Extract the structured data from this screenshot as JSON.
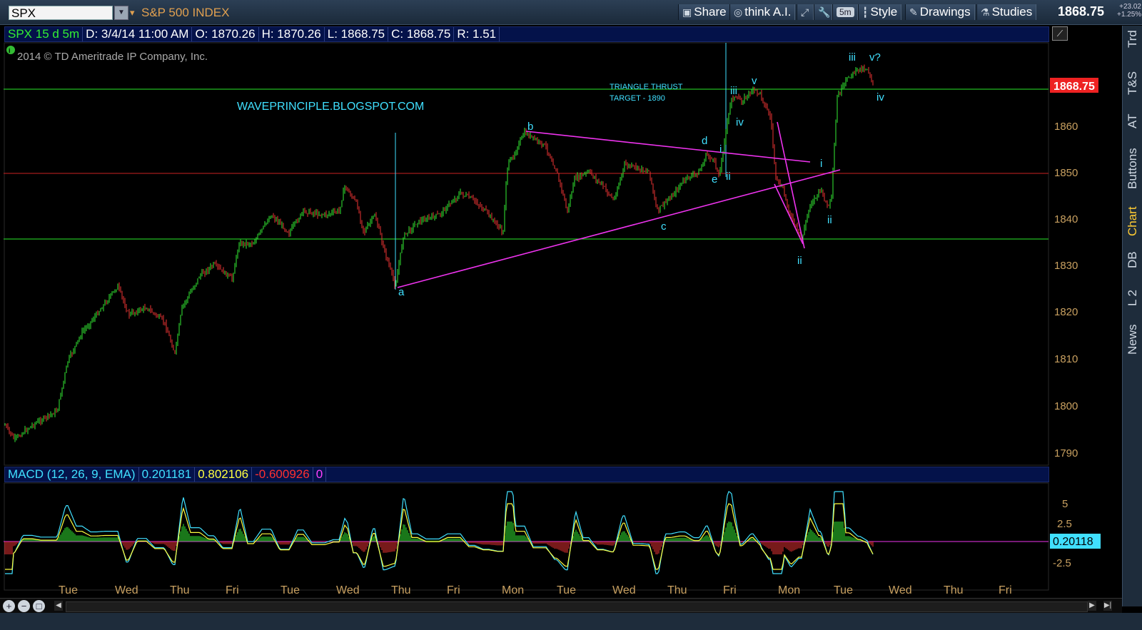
{
  "toolbar": {
    "symbol": "SPX",
    "index_title": "S&P 500 INDEX",
    "share_label": "Share",
    "thinkai_label": "think A.I.",
    "interval_label": "5m",
    "style_label": "Style",
    "drawings_label": "Drawings",
    "studies_label": "Studies",
    "last_price": "1868.75",
    "change_points": "+23.02",
    "change_pct": "+1.25%"
  },
  "right_tabs": [
    "Trd",
    "T&S",
    "AT",
    "Buttons",
    "Chart",
    "DB",
    "L 2",
    "News"
  ],
  "active_tab": "Chart",
  "info_bar": {
    "symbol_period": "SPX 15 d 5m",
    "date": "D: 3/4/14 11:00 AM",
    "open": "O: 1870.26",
    "high": "H: 1870.26",
    "low": "L: 1868.75",
    "close": "C: 1868.75",
    "range": "R: 1.51"
  },
  "copyright": "2014 © TD Ameritrade IP Company, Inc.",
  "annotations": {
    "blog": "WAVEPRINCIPLE.BLOGSPOT.COM",
    "thrust_line1": "TRIANGLE THRUST",
    "thrust_line2": "TARGET - 1890"
  },
  "wave_labels": [
    {
      "text": "a",
      "color": "#40e0ff"
    },
    {
      "text": "b",
      "color": "#40e0ff"
    },
    {
      "text": "c",
      "color": "#40e0ff"
    },
    {
      "text": "d",
      "color": "#40e0ff"
    },
    {
      "text": "e",
      "color": "#40e0ff"
    },
    {
      "text": "i",
      "color": "#40e0ff"
    },
    {
      "text": "ii",
      "color": "#40e0ff"
    },
    {
      "text": "iii",
      "color": "#40e0ff"
    },
    {
      "text": "iv",
      "color": "#40e0ff"
    },
    {
      "text": "v",
      "color": "#40e0ff"
    },
    {
      "text": "ii",
      "color": "#40e0ff"
    },
    {
      "text": "i",
      "color": "#40e0ff"
    },
    {
      "text": "ii",
      "color": "#40e0ff"
    },
    {
      "text": "iii",
      "color": "#40e0ff"
    },
    {
      "text": "v?",
      "color": "#40e0ff"
    },
    {
      "text": "iv",
      "color": "#40e0ff"
    }
  ],
  "price_axis": {
    "ticks": [
      "1790",
      "1800",
      "1810",
      "1820",
      "1830",
      "1840",
      "1850",
      "1860"
    ],
    "current_price_label": "1868.75"
  },
  "macd": {
    "label": "MACD (12, 26, 9, EMA)",
    "value": "0.201181",
    "avg": "0.802106",
    "diff": "-0.600926",
    "zero": "0",
    "value_color": "#40e0ff",
    "avg_color": "#ffff40",
    "diff_color": "#ff3030",
    "zero_color": "#ff40ff",
    "axis_ticks": [
      "5",
      "2.5",
      "-2.5"
    ],
    "current_label": "0.20118"
  },
  "time_axis": [
    "Tue",
    "Wed",
    "Thu",
    "Fri",
    "Tue",
    "Wed",
    "Thu",
    "Fri",
    "Mon",
    "Tue",
    "Wed",
    "Thu",
    "Fri",
    "Mon",
    "Tue",
    "Wed",
    "Thu",
    "Fri"
  ],
  "colors": {
    "up": "#33ee33",
    "down": "#ee3333",
    "support_line": "#22bb22",
    "pivot_line": "#cc2222",
    "trendline": "#ee33ee",
    "annotation": "#40e0ff",
    "axis_text": "#c8a060"
  }
}
